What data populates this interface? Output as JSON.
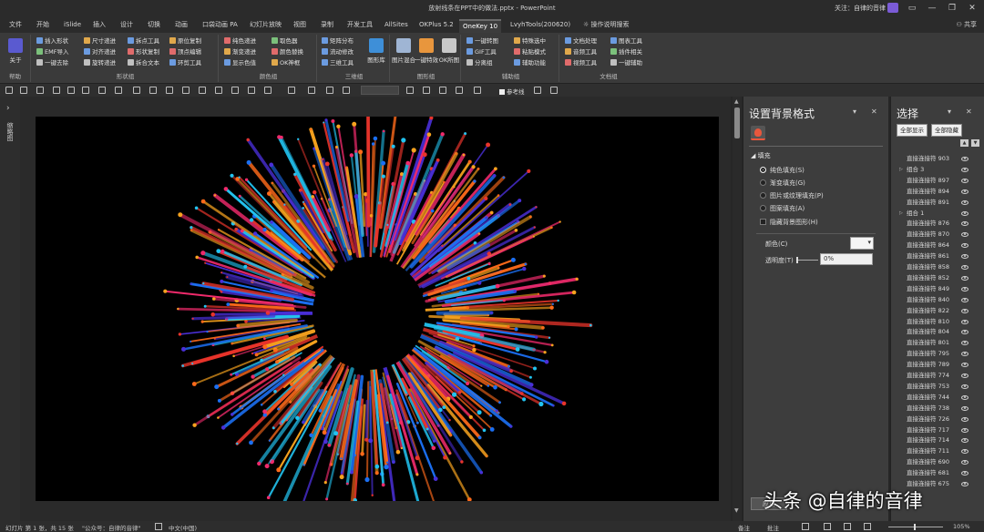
{
  "window": {
    "title": "放射线条在PPT中的做法.pptx - PowerPoint",
    "user_text": "关注：自律的音律",
    "controls": {
      "minimize": "—",
      "restore": "❐",
      "close": "✕",
      "ribbon_options": "▭"
    }
  },
  "tabs": [
    {
      "label": "文件"
    },
    {
      "label": "开始"
    },
    {
      "label": "iSlide"
    },
    {
      "label": "插入"
    },
    {
      "label": "设计"
    },
    {
      "label": "切换"
    },
    {
      "label": "动画"
    },
    {
      "label": "口袋动画 PA"
    },
    {
      "label": "幻灯片放映"
    },
    {
      "label": "视图"
    },
    {
      "label": "录制"
    },
    {
      "label": "开发工具"
    },
    {
      "label": "AllSites"
    },
    {
      "label": "OKPlus 5.2"
    },
    {
      "label": "OneKey 10"
    },
    {
      "label": "LvyhTools(200620)"
    },
    {
      "label": "操作说明搜索"
    }
  ],
  "share_label": "共享",
  "ribbon": {
    "groups": [
      {
        "label": "帮助",
        "big": [
          "关于"
        ]
      },
      {
        "label": "形状组",
        "items": [
          "插入形状",
          "EMF导入",
          "一键去除",
          "尺寸递进",
          "对齐递进",
          "旋转递进",
          "拆点工具",
          "形状复制",
          "拆合文本",
          "原位复制",
          "顶点编辑",
          "环剪工具"
        ]
      },
      {
        "label": "颜色组",
        "items": [
          "纯色递进",
          "渐变递进",
          "显示色值",
          "取色器",
          "颜色替换",
          "OK神框"
        ]
      },
      {
        "label": "三维组",
        "items": [
          "矩阵分布",
          "流动修改",
          "三维工具"
        ],
        "big": [
          "图形库"
        ]
      },
      {
        "label": "图形组",
        "big": [
          "图片混合",
          "一键特效",
          "OK所图"
        ]
      },
      {
        "label": "辅助组",
        "items": [
          "一键转图",
          "GIF工具",
          "分离组",
          "特殊选中",
          "粘贴模式",
          "辅助功能"
        ]
      },
      {
        "label": "文档组",
        "items": [
          "文档处理",
          "音频工具",
          "视频工具",
          "图表工具",
          "插件相关",
          "一键辅助"
        ]
      }
    ]
  },
  "qat": {
    "checkbox_label": "参考线"
  },
  "left_strip": {
    "arrow": "›",
    "label": "缩略图"
  },
  "format_pane": {
    "title": "设置背景格式",
    "section": "◢ 填充",
    "fill_options": [
      {
        "label": "纯色填充(S)",
        "selected": true
      },
      {
        "label": "渐变填充(G)",
        "selected": false
      },
      {
        "label": "图片或纹理填充(P)",
        "selected": false
      },
      {
        "label": "图案填充(A)",
        "selected": false
      }
    ],
    "hide_graphics": "隐藏背景图形(H)",
    "color_label": "颜色(C)",
    "transparency_label": "透明度(T)",
    "transparency_value": "0%",
    "bottom_button": "应用",
    "colors": {
      "accent": "#e8573d"
    }
  },
  "selection_pane": {
    "title": "选择",
    "show_all": "全部显示",
    "hide_all": "全部隐藏",
    "items": [
      {
        "name": "直接连接符 903",
        "group": false
      },
      {
        "name": "组合 3",
        "group": true
      },
      {
        "name": "直接连接符 897",
        "group": false
      },
      {
        "name": "直接连接符 894",
        "group": false
      },
      {
        "name": "直接连接符 891",
        "group": false
      },
      {
        "name": "组合 1",
        "group": true
      },
      {
        "name": "直接连接符 876",
        "group": false
      },
      {
        "name": "直接连接符 870",
        "group": false
      },
      {
        "name": "直接连接符 864",
        "group": false
      },
      {
        "name": "直接连接符 861",
        "group": false
      },
      {
        "name": "直接连接符 858",
        "group": false
      },
      {
        "name": "直接连接符 852",
        "group": false
      },
      {
        "name": "直接连接符 849",
        "group": false
      },
      {
        "name": "直接连接符 840",
        "group": false
      },
      {
        "name": "直接连接符 822",
        "group": false
      },
      {
        "name": "直接连接符 810",
        "group": false
      },
      {
        "name": "直接连接符 804",
        "group": false
      },
      {
        "name": "直接连接符 801",
        "group": false
      },
      {
        "name": "直接连接符 795",
        "group": false
      },
      {
        "name": "直接连接符 789",
        "group": false
      },
      {
        "name": "直接连接符 774",
        "group": false
      },
      {
        "name": "直接连接符 753",
        "group": false
      },
      {
        "name": "直接连接符 744",
        "group": false
      },
      {
        "name": "直接连接符 738",
        "group": false
      },
      {
        "name": "直接连接符 726",
        "group": false
      },
      {
        "name": "直接连接符 717",
        "group": false
      },
      {
        "name": "直接连接符 714",
        "group": false
      },
      {
        "name": "直接连接符 711",
        "group": false
      },
      {
        "name": "直接连接符 690",
        "group": false
      },
      {
        "name": "直接连接符 681",
        "group": false
      },
      {
        "name": "直接连接符 675",
        "group": false
      }
    ]
  },
  "status_bar": {
    "slide_info": "幻灯片 第 1 张，共 15 张",
    "template": "\"公众号：自律的音律\"",
    "language": "中文(中国)",
    "notes": "备注",
    "comments": "批注",
    "zoom": "105%"
  },
  "slide": {
    "background": "#000000",
    "burst_colors": [
      "#e8342b",
      "#f6a21e",
      "#4a2fd8",
      "#ef2a6b",
      "#1b6ff2",
      "#22c3f0",
      "#ff6a1a"
    ]
  },
  "watermark": "头条 @自律的音律"
}
